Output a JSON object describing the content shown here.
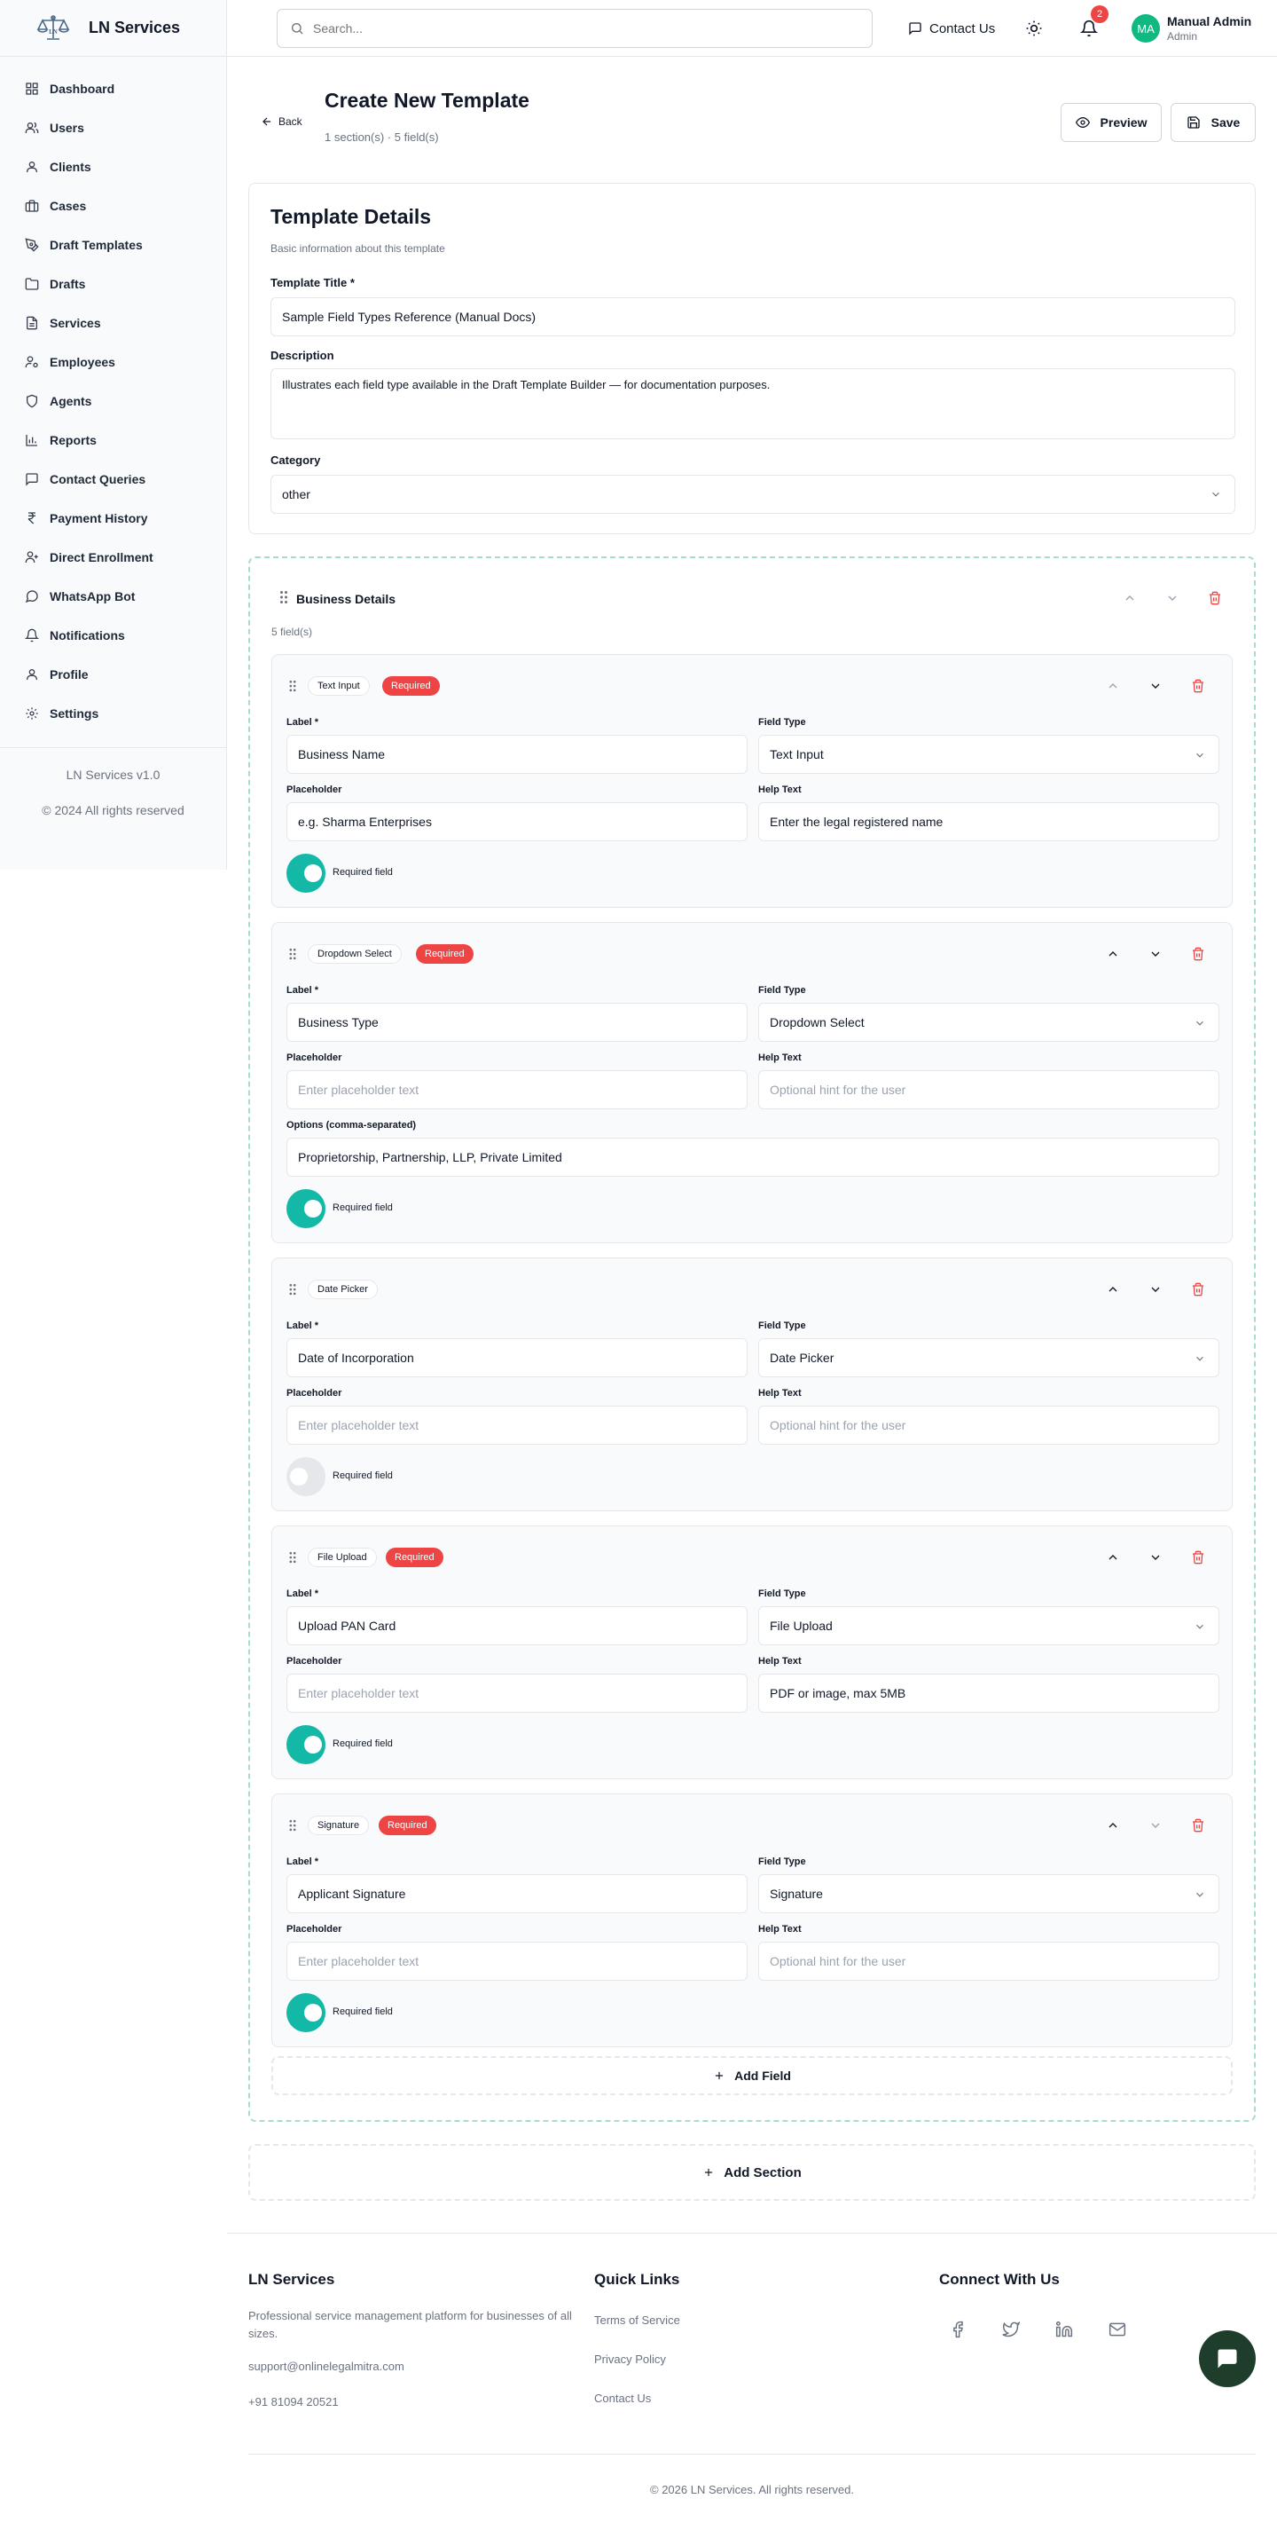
{
  "app": {
    "name": "LN Services",
    "version": "LN Services v1.0",
    "copyright": "© 2024 All rights reserved"
  },
  "sidebar": {
    "items": [
      {
        "label": "Dashboard",
        "icon": "dashboard-icon"
      },
      {
        "label": "Users",
        "icon": "users-icon"
      },
      {
        "label": "Clients",
        "icon": "user-icon"
      },
      {
        "label": "Cases",
        "icon": "briefcase-icon"
      },
      {
        "label": "Draft Templates",
        "icon": "pen-tool-icon"
      },
      {
        "label": "Drafts",
        "icon": "folder-icon"
      },
      {
        "label": "Services",
        "icon": "file-text-icon"
      },
      {
        "label": "Employees",
        "icon": "user-cog-icon"
      },
      {
        "label": "Agents",
        "icon": "shield-icon"
      },
      {
        "label": "Reports",
        "icon": "bar-chart-icon"
      },
      {
        "label": "Contact Queries",
        "icon": "message-square-icon"
      },
      {
        "label": "Payment History",
        "icon": "rupee-icon"
      },
      {
        "label": "Direct Enrollment",
        "icon": "user-plus-icon"
      },
      {
        "label": "WhatsApp Bot",
        "icon": "message-circle-icon"
      },
      {
        "label": "Notifications",
        "icon": "bell-icon"
      },
      {
        "label": "Profile",
        "icon": "user-icon"
      },
      {
        "label": "Settings",
        "icon": "gear-icon"
      }
    ]
  },
  "header": {
    "search_placeholder": "Search...",
    "contact_label": "Contact Us",
    "notification_count": "2",
    "user": {
      "initials": "MA",
      "name": "Manual Admin",
      "role": "Admin"
    }
  },
  "page": {
    "back_label": "Back",
    "title": "Create New Template",
    "subtitle": "1 section(s) · 5 field(s)",
    "preview_label": "Preview",
    "save_label": "Save"
  },
  "details": {
    "title": "Template Details",
    "subtitle": "Basic information about this template",
    "title_label": "Template Title *",
    "title_value": "Sample Field Types Reference (Manual Docs)",
    "description_label": "Description",
    "description_value": "Illustrates each field type available in the Draft Template Builder — for documentation purposes.",
    "category_label": "Category",
    "category_value": "other"
  },
  "section": {
    "title": "Business Details",
    "count": "5 field(s)",
    "add_field_label": "Add Field"
  },
  "field_labels": {
    "label": "Label *",
    "type": "Field Type",
    "placeholder": "Placeholder",
    "help": "Help Text",
    "options": "Options (comma-separated)",
    "required_toggle": "Required field",
    "required_badge": "Required",
    "placeholder_hint": "Enter placeholder text",
    "help_hint": "Optional hint for the user"
  },
  "fields": [
    {
      "type_badge": "Text Input",
      "label": "Business Name",
      "field_type": "Text Input",
      "placeholder": "e.g. Sharma Enterprises",
      "help": "Enter the legal registered name"
    },
    {
      "type_badge": "Dropdown Select",
      "label": "Business Type",
      "field_type": "Dropdown Select",
      "placeholder": "",
      "help": "",
      "options": "Proprietorship, Partnership, LLP, Private Limited"
    },
    {
      "type_badge": "Date Picker",
      "label": "Date of Incorporation",
      "field_type": "Date Picker",
      "placeholder": "",
      "help": ""
    },
    {
      "type_badge": "File Upload",
      "label": "Upload PAN Card",
      "field_type": "File Upload",
      "placeholder": "",
      "help": "PDF or image, max 5MB"
    },
    {
      "type_badge": "Signature",
      "label": "Applicant Signature",
      "field_type": "Signature",
      "placeholder": "",
      "help": ""
    }
  ],
  "add_section_label": "Add Section",
  "footer": {
    "brand": "LN Services",
    "description": "Professional service management platform for businesses of all sizes.",
    "email": "support@onlinelegalmitra.com",
    "phone": "+91 81094 20521",
    "quick_links_title": "Quick Links",
    "links": [
      "Terms of Service",
      "Privacy Policy",
      "Contact Us"
    ],
    "connect_title": "Connect With Us",
    "social": [
      "facebook-icon",
      "twitter-icon",
      "linkedin-icon",
      "mail-icon"
    ],
    "copyright": "© 2026 LN Services. All rights reserved."
  },
  "colors": {
    "accent": "#14b8a6",
    "danger": "#ef4444",
    "avatar": "#10b981",
    "chat": "#1f3d2b"
  }
}
